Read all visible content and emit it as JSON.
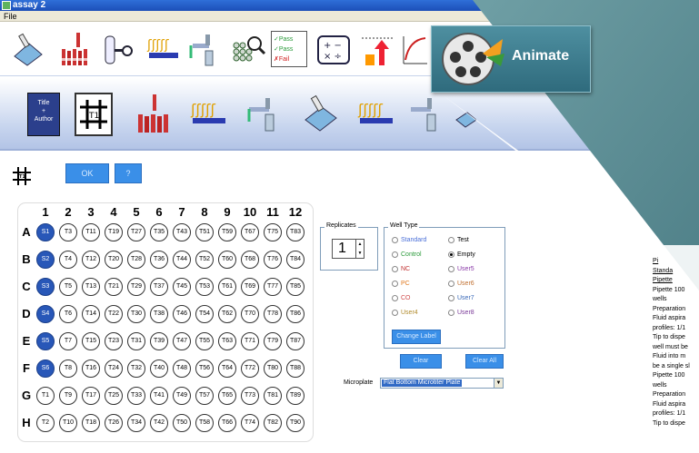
{
  "window": {
    "title": "assay 2"
  },
  "menu": {
    "file": "File"
  },
  "toolbar_top": {
    "icons": [
      "pipette-plate-icon",
      "tube-rack-icon",
      "tube-key-icon",
      "liquid-dispense-icon",
      "wash-tap-icon",
      "microplate-search-icon",
      "pass-fail-icon",
      "calculator-icon",
      "arrow-up-chart-icon",
      "curve-graph-icon"
    ],
    "pass_fail_lines": [
      "✓Pass",
      "✓Pass",
      "✗Fail"
    ],
    "calc_symbols": "+ −\n× ÷"
  },
  "animate": {
    "label": "Animate"
  },
  "toolbar_steps": {
    "title_author_lines": [
      "Title",
      "+",
      "Author"
    ],
    "plate_label": "T1"
  },
  "content": {
    "plate_icon_label": "T1",
    "ok_label": "OK",
    "help_label": "?"
  },
  "plate": {
    "columns": [
      "1",
      "2",
      "3",
      "4",
      "5",
      "6",
      "7",
      "8",
      "9",
      "10",
      "11",
      "12"
    ],
    "rows": [
      "A",
      "B",
      "C",
      "D",
      "E",
      "F",
      "G",
      "H"
    ],
    "wells": [
      [
        "S1",
        "T3",
        "T11",
        "T19",
        "T27",
        "T35",
        "T43",
        "T51",
        "T59",
        "T67",
        "T75",
        "T83"
      ],
      [
        "S2",
        "T4",
        "T12",
        "T20",
        "T28",
        "T36",
        "T44",
        "T52",
        "T60",
        "T68",
        "T76",
        "T84"
      ],
      [
        "S3",
        "T5",
        "T13",
        "T21",
        "T29",
        "T37",
        "T45",
        "T53",
        "T61",
        "T69",
        "T77",
        "T85"
      ],
      [
        "S4",
        "T6",
        "T14",
        "T22",
        "T30",
        "T38",
        "T46",
        "T54",
        "T62",
        "T70",
        "T78",
        "T86"
      ],
      [
        "S5",
        "T7",
        "T15",
        "T23",
        "T31",
        "T39",
        "T47",
        "T55",
        "T63",
        "T71",
        "T79",
        "T87"
      ],
      [
        "S6",
        "T8",
        "T16",
        "T24",
        "T32",
        "T40",
        "T48",
        "T56",
        "T64",
        "T72",
        "T80",
        "T88"
      ],
      [
        "T1",
        "T9",
        "T17",
        "T25",
        "T33",
        "T41",
        "T49",
        "T57",
        "T65",
        "T73",
        "T81",
        "T89"
      ],
      [
        "T2",
        "T10",
        "T18",
        "T26",
        "T34",
        "T42",
        "T50",
        "T58",
        "T66",
        "T74",
        "T82",
        "T90"
      ]
    ],
    "filled_color": "#2857b8"
  },
  "replicates": {
    "label": "Replicates",
    "value": "1"
  },
  "well_type": {
    "label": "Well Type",
    "options": [
      {
        "label": "Standard",
        "color": "#4a6fd8",
        "selected": false
      },
      {
        "label": "Test",
        "color": "#000000",
        "selected": false
      },
      {
        "label": "Control",
        "color": "#2a9a3a",
        "selected": false
      },
      {
        "label": "Empty",
        "color": "#000000",
        "selected": true
      },
      {
        "label": "NC",
        "color": "#c03030",
        "selected": false
      },
      {
        "label": "User5",
        "color": "#8a3aa8",
        "selected": false
      },
      {
        "label": "PC",
        "color": "#e07a20",
        "selected": false
      },
      {
        "label": "User6",
        "color": "#c07030",
        "selected": false
      },
      {
        "label": "CO",
        "color": "#d04a4a",
        "selected": false
      },
      {
        "label": "User7",
        "color": "#3a6ab8",
        "selected": false
      },
      {
        "label": "User4",
        "color": "#b08a2a",
        "selected": false
      },
      {
        "label": "User8",
        "color": "#7a3a98",
        "selected": false
      }
    ],
    "change_label": "Change Label"
  },
  "actions": {
    "clear": "Clear",
    "clear_all": "Clear All"
  },
  "microplate": {
    "label": "Microplate",
    "value": "Flat Bottom Microtiter Plate"
  },
  "doc_panel": {
    "lines": [
      {
        "text": "Pi",
        "u": true
      },
      {
        "text": "Standa",
        "u": true
      },
      {
        "text": "Pipette",
        "u": true
      },
      {
        "text": "  Pipette 100",
        "u": false
      },
      {
        "text": "wells",
        "u": false
      },
      {
        "text": "  Preparation",
        "u": false
      },
      {
        "text": "  Fluid aspira",
        "u": false
      },
      {
        "text": "profiles: 1/1",
        "u": false
      },
      {
        "text": "  Tip to dispe",
        "u": false
      },
      {
        "text": "well must be",
        "u": false
      },
      {
        "text": "  Fluid into m",
        "u": false
      },
      {
        "text": "be a single sl",
        "u": false
      },
      {
        "text": "  Pipette 100",
        "u": false
      },
      {
        "text": "wells",
        "u": false
      },
      {
        "text": "  Preparation",
        "u": false
      },
      {
        "text": "  Fluid aspira",
        "u": false
      },
      {
        "text": "profiles: 1/1",
        "u": false
      },
      {
        "text": "  Tip to dispe",
        "u": false
      }
    ]
  }
}
